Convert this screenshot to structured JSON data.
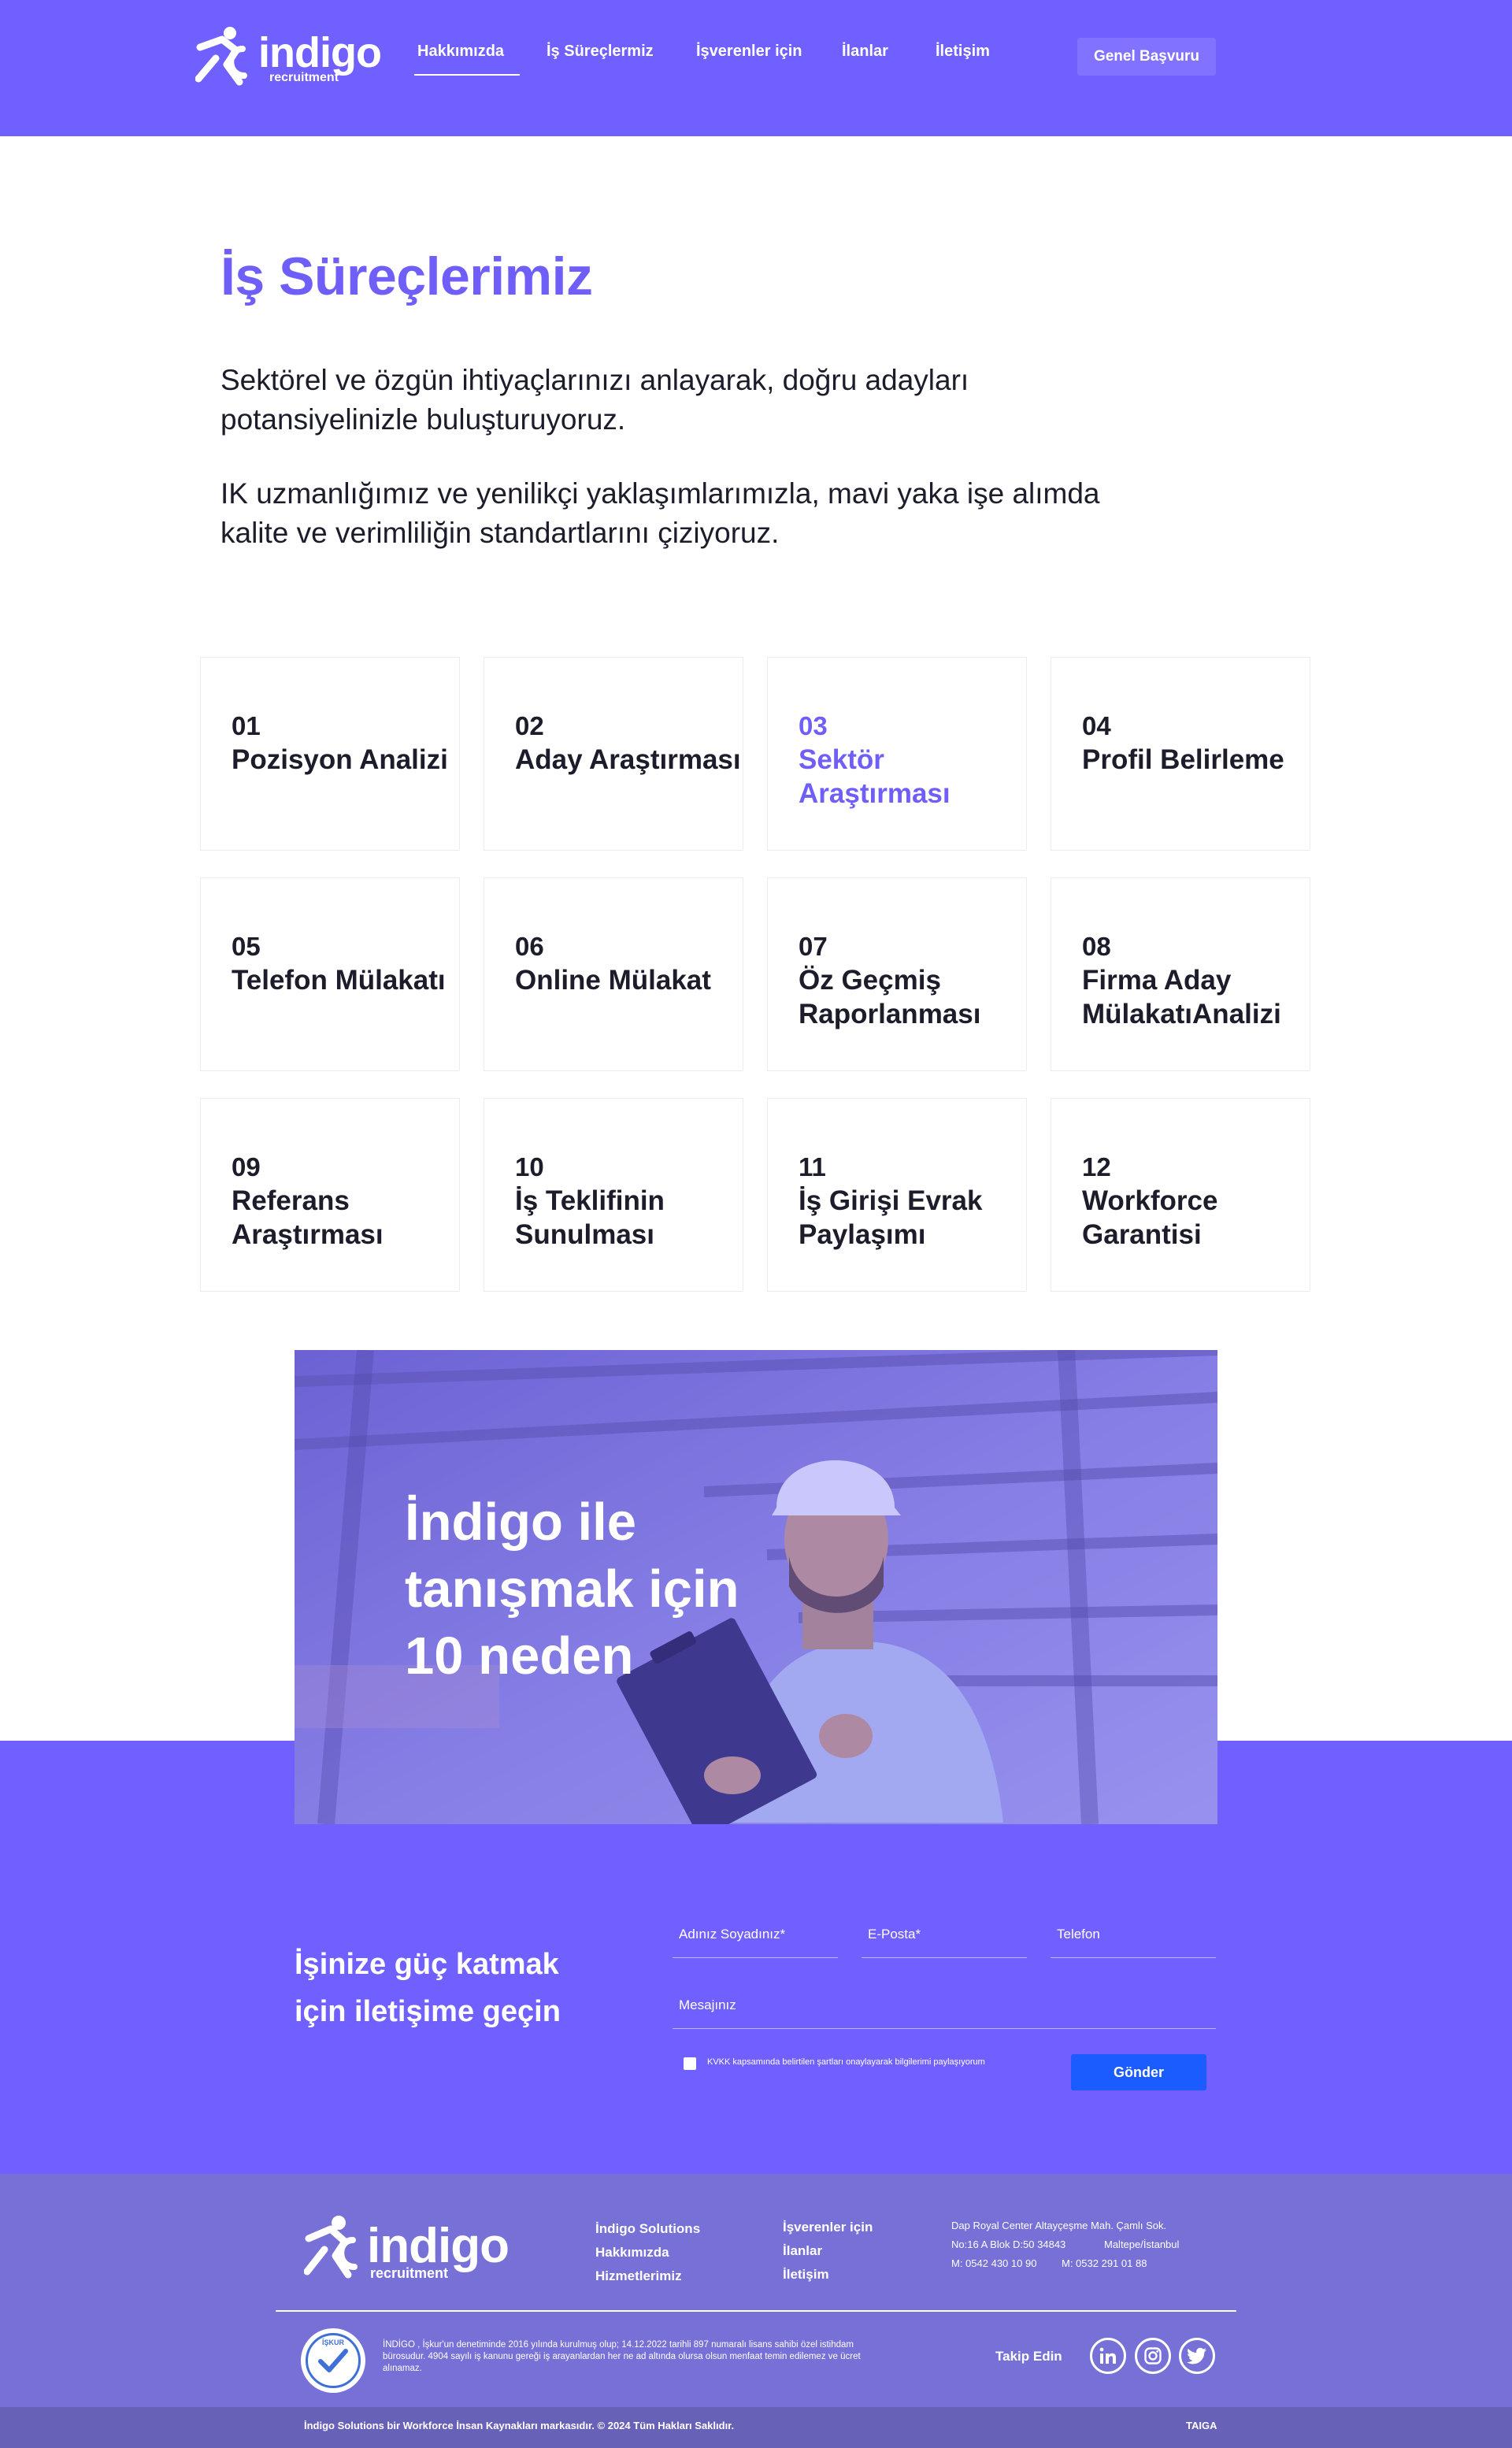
{
  "header": {
    "logo_text": "indigo",
    "logo_subtext": "recruitment",
    "nav": [
      "Hakkımızda",
      "İş Süreçlermiz",
      "İşverenler için",
      "İlanlar",
      "İletişim"
    ],
    "apply_button": "Genel Başvuru"
  },
  "intro": {
    "title": "İş Süreçlerimiz",
    "paragraph1": "Sektörel ve özgün ihtiyaçlarınızı anlayarak, doğru adayları potansiyelinizle buluşturuyoruz.",
    "paragraph2": "IK uzmanlığımız ve yenilikçi yaklaşımlarımızla, mavi yaka işe alımda kalite ve verimliliğin standartlarını çiziyoruz."
  },
  "process_cards": [
    {
      "num": "01",
      "label": "Pozisyon Analizi"
    },
    {
      "num": "02",
      "label": "Aday Araştırması"
    },
    {
      "num": "03",
      "label": "Sektör Araştırması"
    },
    {
      "num": "04",
      "label": "Profil Belirleme"
    },
    {
      "num": "05",
      "label": "Telefon Mülakatı"
    },
    {
      "num": "06",
      "label": "Online Mülakat"
    },
    {
      "num": "07",
      "label": "Öz Geçmiş Raporlanması"
    },
    {
      "num": "08",
      "label": "Firma Aday MülakatıAnalizi"
    },
    {
      "num": "09",
      "label": "Referans Araştırması"
    },
    {
      "num": "10",
      "label": "İş Teklifinin Sunulması"
    },
    {
      "num": "11",
      "label": "İş Girişi Evrak Paylaşımı"
    },
    {
      "num": "12",
      "label": "Workforce Garantisi"
    }
  ],
  "active_card": "03",
  "promo": {
    "title": "İndigo ile tanışmak için 10 neden"
  },
  "contact": {
    "heading": "İşinize güç katmak için iletişime geçin",
    "name_placeholder": "Adınız Soyadınız*",
    "email_placeholder": "E-Posta*",
    "phone_placeholder": "Telefon",
    "message_placeholder": "Mesajınız",
    "consent": "KVKK kapsamında belirtilen şartları onaylayarak bilgilerimi paylaşıyorum",
    "send_button": "Gönder"
  },
  "footer": {
    "col1": [
      "İndigo Solutions",
      "Hakkımızda",
      "Hizmetlerimiz"
    ],
    "col2": [
      "İşverenler için",
      "İlanlar",
      "İletişim"
    ],
    "address_line1": "Dap Royal Center Altayçeşme Mah. Çamlı Sok.",
    "address_line2": "No:16 A Blok D:50 34843",
    "address_city": "Maltepe/İstanbul",
    "phone1": "M: 0542 430 10 90",
    "phone2": "M: 0532 291 01 88",
    "iskur_badge": "İŞKUR",
    "legal_text": "İNDİGO , İşkur'un denetiminde 2016 yılında kurulmuş olup; 14.12.2022 tarihli 897 numaralı lisans sahibi özel istihdam bürosudur. 4904 sayılı iş kanunu gereği iş arayanlardan her ne ad altında olursa olsun menfaat temin edilemez ve ücret alınamaz.",
    "follow_label": "Takip Edin",
    "copyright": "İndigo Solutions bir Workforce İnsan Kaynakları markasıdır.  © 2024 Tüm Hakları Saklıdır.",
    "credit": "TAIGA"
  },
  "colors": {
    "brand": "#7060ff",
    "accent_text": "#6f5ff8",
    "send_button": "#1a5cff",
    "footer": "#7770d6"
  }
}
